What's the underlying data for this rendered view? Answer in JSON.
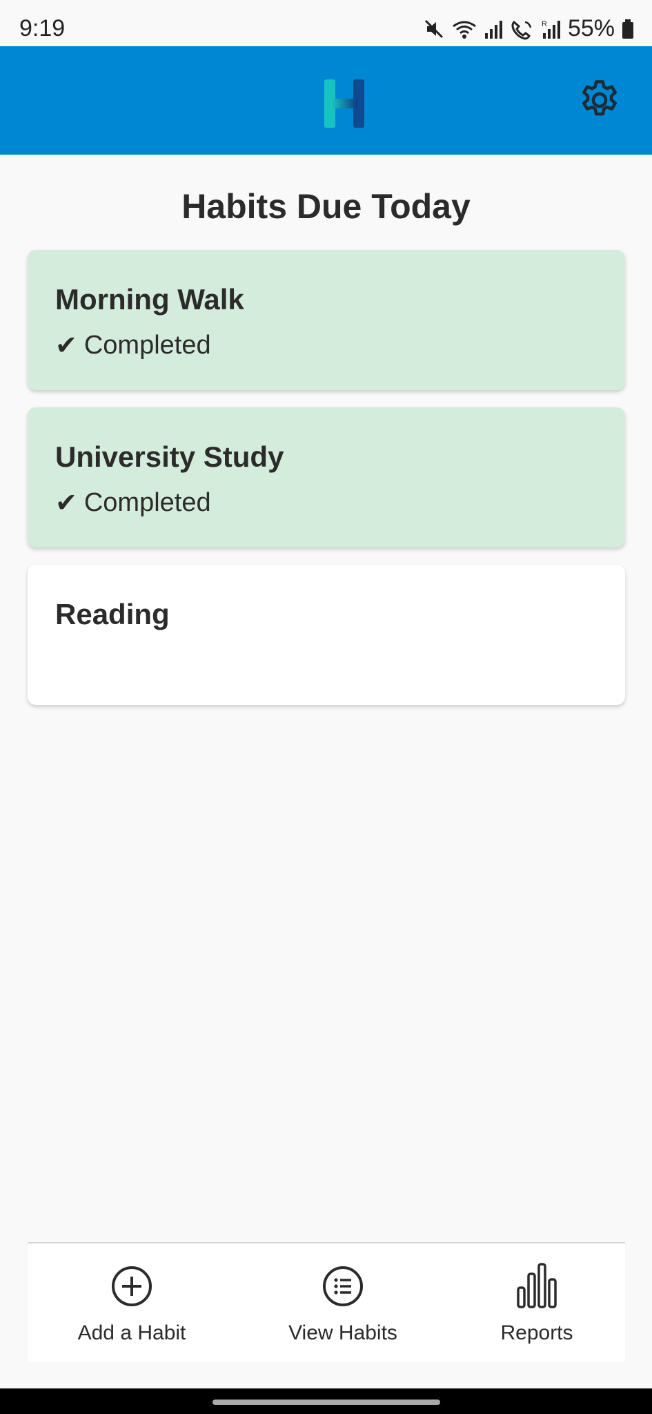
{
  "status_bar": {
    "time": "9:19",
    "battery": "55%",
    "icons": [
      "mute-icon",
      "wifi-icon",
      "signal-icon",
      "wifi-calling-icon",
      "signal-2-icon",
      "battery-icon"
    ]
  },
  "app_bar": {
    "logo": "habit-app-logo",
    "settings_icon": "gear-icon",
    "bg_color": "#0087d3"
  },
  "main": {
    "title": "Habits Due Today",
    "habits": [
      {
        "name": "Morning Walk",
        "status": "Completed",
        "completed": true
      },
      {
        "name": "University Study",
        "status": "Completed",
        "completed": true
      },
      {
        "name": "Reading",
        "status": "",
        "completed": false
      }
    ],
    "check_glyph": "✔",
    "completed_color": "#d4ecdb"
  },
  "bottom_nav": {
    "items": [
      {
        "label": "Add a Habit",
        "icon": "plus-circle-icon"
      },
      {
        "label": "View Habits",
        "icon": "list-icon"
      },
      {
        "label": "Reports",
        "icon": "bar-chart-icon"
      }
    ]
  }
}
